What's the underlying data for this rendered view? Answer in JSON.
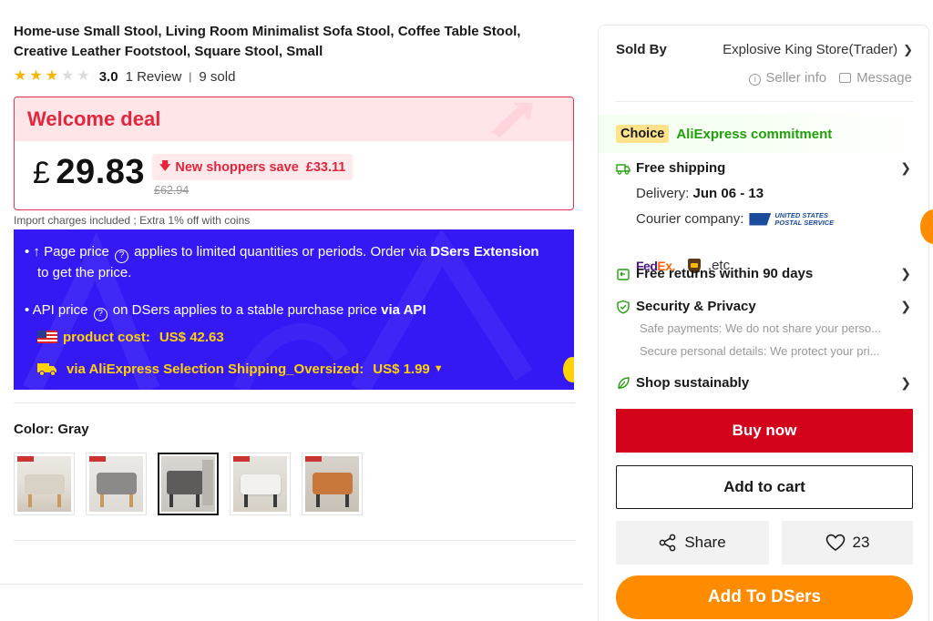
{
  "product": {
    "title": "Home-use Small Stool, Living Room Minimalist Sofa Stool, Coffee Table Stool, Creative Leather Footstool, Square Stool, Small",
    "rating": "3.0",
    "rating_fraction": 0.6,
    "reviews": "1 Review",
    "separator": "|",
    "sold": "9 sold"
  },
  "deal": {
    "title": "Welcome deal",
    "currency": "£",
    "price": "29.83",
    "savings_label": "New shoppers save",
    "savings_amount": "£33.11",
    "old_price": "£62.94"
  },
  "import_note": "Import charges included ; Extra 1% off with coins",
  "dsers": {
    "line1_prefix": "• ↑ Page price",
    "line1_mid": "applies to limited quantities or periods. Order via",
    "line1_bold": "DSers Extension",
    "line1_suffix": "to get the price.",
    "line2_prefix": "• API price",
    "line2_mid": "on DSers applies to a stable purchase price",
    "line2_bold": "via API",
    "product_cost_label": "product cost:",
    "product_cost_value": "US$ 42.63",
    "shipping_label": "via AliExpress Selection Shipping_Oversized:",
    "shipping_value": "US$ 1.99"
  },
  "color": {
    "label": "Color:",
    "value": "Gray",
    "swatches": [
      "Beige",
      "Gray light",
      "Gray",
      "White",
      "Orange"
    ],
    "selected_index": 2
  },
  "seller": {
    "sold_by_label": "Sold By",
    "store_name": "Explosive King Store(Trader)",
    "seller_info": "Seller info",
    "message": "Message"
  },
  "choice": {
    "badge": "Choice",
    "commitment": "AliExpress commitment"
  },
  "shipping": {
    "title": "Free shipping",
    "delivery_label": "Delivery:",
    "delivery_dates": "Jun 06 - 13",
    "courier_label": "Courier company:",
    "usps_text_1": "UNITED STATES",
    "usps_text_2": "POSTAL SERVICE",
    "fedex_fe": "Fed",
    "fedex_ex": "Ex.",
    "etc": ",etc."
  },
  "returns": {
    "title": "Free returns within 90 days"
  },
  "security": {
    "title": "Security & Privacy",
    "line1": "Safe payments: We do not share your perso...",
    "line2": "Secure personal details: We protect your pri..."
  },
  "sustain": {
    "title": "Shop sustainably"
  },
  "actions": {
    "buy_now": "Buy now",
    "add_to_cart": "Add to cart",
    "share": "Share",
    "likes": "23",
    "add_to_dsers": "Add To DSers"
  },
  "colors": {
    "accent_red": "#d3031c",
    "deal_red": "#e2263d",
    "dsers_blue": "#3419f5",
    "dsers_yellow": "#ffd200",
    "dsers_orange": "#ff8b00",
    "choice_green": "#20a10a",
    "star_gold": "#f7b500"
  }
}
